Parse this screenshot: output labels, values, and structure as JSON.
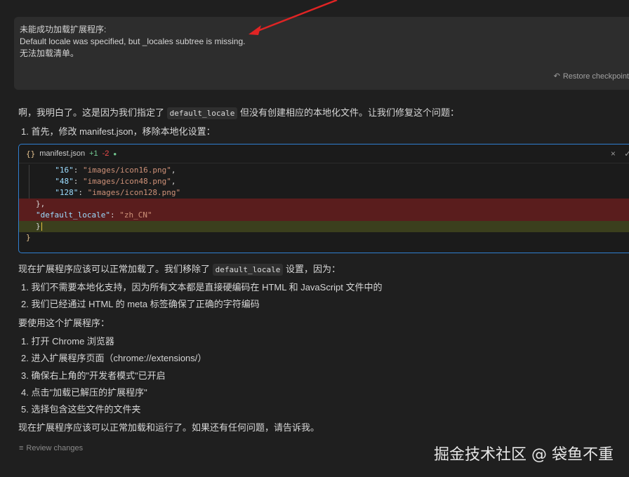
{
  "user_message": {
    "line1": "未能成功加载扩展程序:",
    "line2": "Default locale was specified, but _locales subtree is missing.",
    "line3": "无法加载清单。",
    "restore_label": "Restore checkpoint"
  },
  "response": {
    "intro_pre": "啊，我明白了。这是因为我们指定了",
    "intro_code": "default_locale",
    "intro_post": "但没有创建相应的本地化文件。让我们修复这个问题：",
    "step1": "1. 首先，修改 manifest.json，移除本地化设置：",
    "code_block": {
      "filename": "manifest.json",
      "added": "+1",
      "removed": "-2",
      "lines": [
        {
          "key": "\"16\"",
          "sep": ": ",
          "val": "\"images/icon16.png\"",
          "end": ","
        },
        {
          "key": "\"48\"",
          "sep": ": ",
          "val": "\"images/icon48.png\"",
          "end": ","
        },
        {
          "key": "\"128\"",
          "sep": ": ",
          "val": "\"images/icon128.png\"",
          "end": ""
        },
        {
          "text": "},"
        },
        {
          "key": "\"default_locale\"",
          "sep": ": ",
          "val": "\"zh_CN\"",
          "end": ""
        },
        {
          "text": "}"
        },
        {
          "text": "}"
        }
      ]
    },
    "after_pre": "现在扩展程序应该可以正常加载了。我们移除了",
    "after_code": "default_locale",
    "after_post": "设置，因为：",
    "reasons": [
      "1. 我们不需要本地化支持，因为所有文本都是直接硬编码在 HTML 和 JavaScript 文件中的",
      "2. 我们已经通过 HTML 的 meta 标签确保了正确的字符编码"
    ],
    "usage_heading": "要使用这个扩展程序：",
    "usage_steps": [
      "1. 打开 Chrome 浏览器",
      "2. 进入扩展程序页面（chrome://extensions/）",
      "3. 确保右上角的\"开发者模式\"已开启",
      "4. 点击\"加载已解压的扩展程序\"",
      "5. 选择包含这些文件的文件夹"
    ],
    "closing": "现在扩展程序应该可以正常加载和运行了。如果还有任何问题，请告诉我。"
  },
  "footer": {
    "review_label": "Review changes",
    "watermark": "掘金技术社区 @ 袋鱼不重"
  },
  "colors": {
    "annotation_arrow": "#e02424",
    "code_block_border": "#2f7fd1",
    "deleted_line_bg": "#5a1d1d",
    "added_line_bg": "#3b3f1d"
  }
}
